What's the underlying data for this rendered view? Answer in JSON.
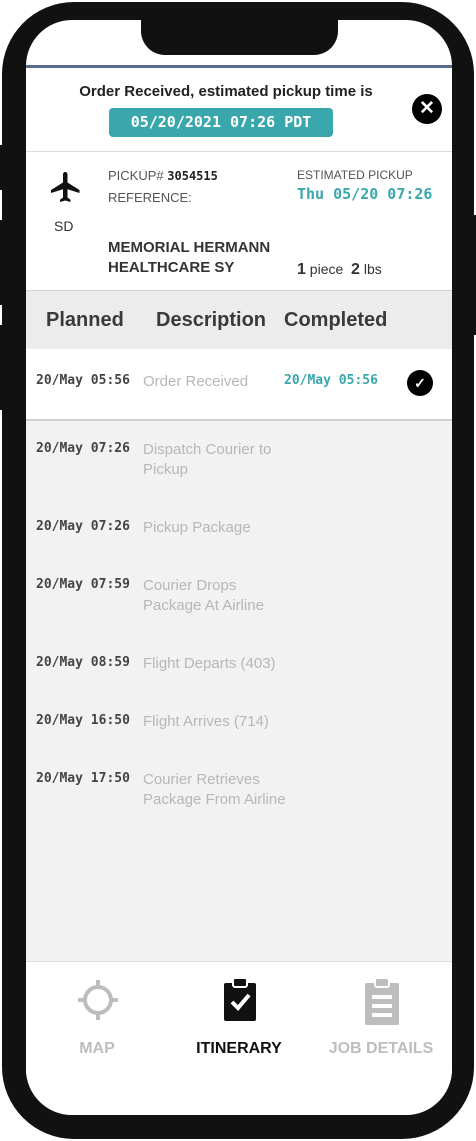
{
  "banner": {
    "message": "Order Received, estimated pickup time is",
    "time": "05/20/2021 07:26 PDT",
    "close_icon": "close-icon"
  },
  "summary": {
    "mode_icon": "airplane-icon",
    "station": "SD",
    "pickup_label": "PICKUP#",
    "pickup_number": "3054515",
    "reference_label": "REFERENCE:",
    "estimated_label": "ESTIMATED PICKUP",
    "estimated_value": "Thu 05/20 07:26",
    "company_line1": "MEMORIAL HERMANN",
    "company_line2": "HEALTHCARE SY",
    "pieces_count": "1",
    "pieces_label": "piece",
    "weight_value": "2",
    "weight_unit": "lbs"
  },
  "columns": {
    "planned": "Planned",
    "description": "Description",
    "completed": "Completed"
  },
  "itinerary": [
    {
      "planned": "20/May 05:56",
      "description": "Order Received",
      "completed": "20/May 05:56",
      "done": true
    },
    {
      "planned": "20/May 07:26",
      "description": "Dispatch Courier to Pickup",
      "completed": "",
      "done": false
    },
    {
      "planned": "20/May 07:26",
      "description": "Pickup Package",
      "completed": "",
      "done": false
    },
    {
      "planned": "20/May 07:59",
      "description": "Courier Drops Package At Airline",
      "completed": "",
      "done": false
    },
    {
      "planned": "20/May 08:59",
      "description": "Flight Departs (403)",
      "completed": "",
      "done": false
    },
    {
      "planned": "20/May 16:50",
      "description": "Flight Arrives (714)",
      "completed": "",
      "done": false
    },
    {
      "planned": "20/May 17:50",
      "description": "Courier Retrieves Package From Airline",
      "completed": "",
      "done": false
    }
  ],
  "nav": {
    "map_label": "MAP",
    "itinerary_label": "ITINERARY",
    "job_details_label": "JOB DETAILS",
    "map_icon": "crosshair-icon",
    "itinerary_icon": "clipboard-check-icon",
    "job_details_icon": "clipboard-list-icon"
  },
  "colors": {
    "accent": "#3aa7ad",
    "inactive": "#bdbdbd",
    "active": "#111111"
  }
}
